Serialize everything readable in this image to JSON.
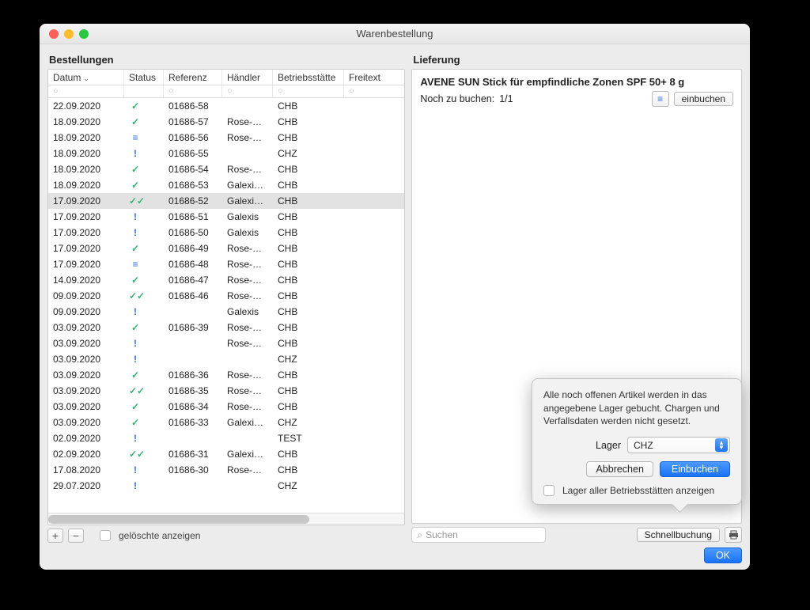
{
  "window": {
    "title": "Warenbestellung"
  },
  "left": {
    "title": "Bestellungen",
    "columns": {
      "datum": "Datum",
      "status": "Status",
      "referenz": "Referenz",
      "haendler": "Händler",
      "betriebsstaette": "Betriebsstätte",
      "freitext": "Freitext"
    },
    "filter_placeholder": "○",
    "rows": [
      {
        "datum": "22.09.2020",
        "status": "check",
        "ref": "01686-58",
        "hand": "",
        "bs": "CHB",
        "sel": false
      },
      {
        "datum": "18.09.2020",
        "status": "check",
        "ref": "01686-57",
        "hand": "Rose-C…",
        "bs": "CHB",
        "sel": false
      },
      {
        "datum": "18.09.2020",
        "status": "list",
        "ref": "01686-56",
        "hand": "Rose-C…",
        "bs": "CHB",
        "sel": false
      },
      {
        "datum": "18.09.2020",
        "status": "excl",
        "ref": "01686-55",
        "hand": "",
        "bs": "CHZ",
        "sel": false
      },
      {
        "datum": "18.09.2020",
        "status": "check",
        "ref": "01686-54",
        "hand": "Rose-C…",
        "bs": "CHB",
        "sel": false
      },
      {
        "datum": "18.09.2020",
        "status": "check",
        "ref": "01686-53",
        "hand": "Galexis…",
        "bs": "CHB",
        "sel": false
      },
      {
        "datum": "17.09.2020",
        "status": "dcheck",
        "ref": "01686-52",
        "hand": "Galexis…",
        "bs": "CHB",
        "sel": true
      },
      {
        "datum": "17.09.2020",
        "status": "excl",
        "ref": "01686-51",
        "hand": "Galexis",
        "bs": "CHB",
        "sel": false
      },
      {
        "datum": "17.09.2020",
        "status": "excl",
        "ref": "01686-50",
        "hand": "Galexis",
        "bs": "CHB",
        "sel": false
      },
      {
        "datum": "17.09.2020",
        "status": "check",
        "ref": "01686-49",
        "hand": "Rose-C…",
        "bs": "CHB",
        "sel": false
      },
      {
        "datum": "17.09.2020",
        "status": "list",
        "ref": "01686-48",
        "hand": "Rose-C…",
        "bs": "CHB",
        "sel": false
      },
      {
        "datum": "14.09.2020",
        "status": "check",
        "ref": "01686-47",
        "hand": "Rose-C…",
        "bs": "CHB",
        "sel": false
      },
      {
        "datum": "09.09.2020",
        "status": "dcheck",
        "ref": "01686-46",
        "hand": "Rose-C…",
        "bs": "CHB",
        "sel": false
      },
      {
        "datum": "09.09.2020",
        "status": "excl",
        "ref": "",
        "hand": "Galexis",
        "bs": "CHB",
        "sel": false
      },
      {
        "datum": "03.09.2020",
        "status": "check",
        "ref": "01686-39",
        "hand": "Rose-C…",
        "bs": "CHB",
        "sel": false
      },
      {
        "datum": "03.09.2020",
        "status": "excl",
        "ref": "",
        "hand": "Rose-C…",
        "bs": "CHB",
        "sel": false
      },
      {
        "datum": "03.09.2020",
        "status": "excl",
        "ref": "",
        "hand": "",
        "bs": "CHZ",
        "sel": false
      },
      {
        "datum": "03.09.2020",
        "status": "check",
        "ref": "01686-36",
        "hand": "Rose-C…",
        "bs": "CHB",
        "sel": false
      },
      {
        "datum": "03.09.2020",
        "status": "dcheck",
        "ref": "01686-35",
        "hand": "Rose-C…",
        "bs": "CHB",
        "sel": false
      },
      {
        "datum": "03.09.2020",
        "status": "check",
        "ref": "01686-34",
        "hand": "Rose-C…",
        "bs": "CHB",
        "sel": false
      },
      {
        "datum": "03.09.2020",
        "status": "check",
        "ref": "01686-33",
        "hand": "Galexis…",
        "bs": "CHZ",
        "sel": false
      },
      {
        "datum": "02.09.2020",
        "status": "excl",
        "ref": "",
        "hand": "",
        "bs": "TEST",
        "sel": false
      },
      {
        "datum": "02.09.2020",
        "status": "dcheck",
        "ref": "01686-31",
        "hand": "Galexis…",
        "bs": "CHB",
        "sel": false
      },
      {
        "datum": "17.08.2020",
        "status": "excl",
        "ref": "01686-30",
        "hand": "Rose-C…",
        "bs": "CHB",
        "sel": false
      },
      {
        "datum": "29.07.2020",
        "status": "excl",
        "ref": "",
        "hand": "",
        "bs": "CHZ",
        "sel": false
      }
    ],
    "footer": {
      "add": "+",
      "remove": "−",
      "deleted_label": "gelöschte anzeigen"
    }
  },
  "right": {
    "title": "Lieferung",
    "article": "AVENE SUN Stick für empfindliche Zonen SPF 50+ 8 g",
    "to_book_label": "Noch zu buchen:",
    "to_book_value": "1/1",
    "einbuchen_btn": "einbuchen",
    "search_placeholder": "Suchen",
    "schnell_label": "Schnellbuchung"
  },
  "popover": {
    "text": "Alle noch offenen Artikel werden in das angegebene Lager gebucht. Chargen und Verfallsdaten werden nicht gesetzt.",
    "lager_label": "Lager",
    "lager_value": "CHZ",
    "cancel": "Abbrechen",
    "confirm": "Einbuchen",
    "checkbox_label": "Lager aller Betriebsstätten anzeigen"
  },
  "ok_label": "OK"
}
